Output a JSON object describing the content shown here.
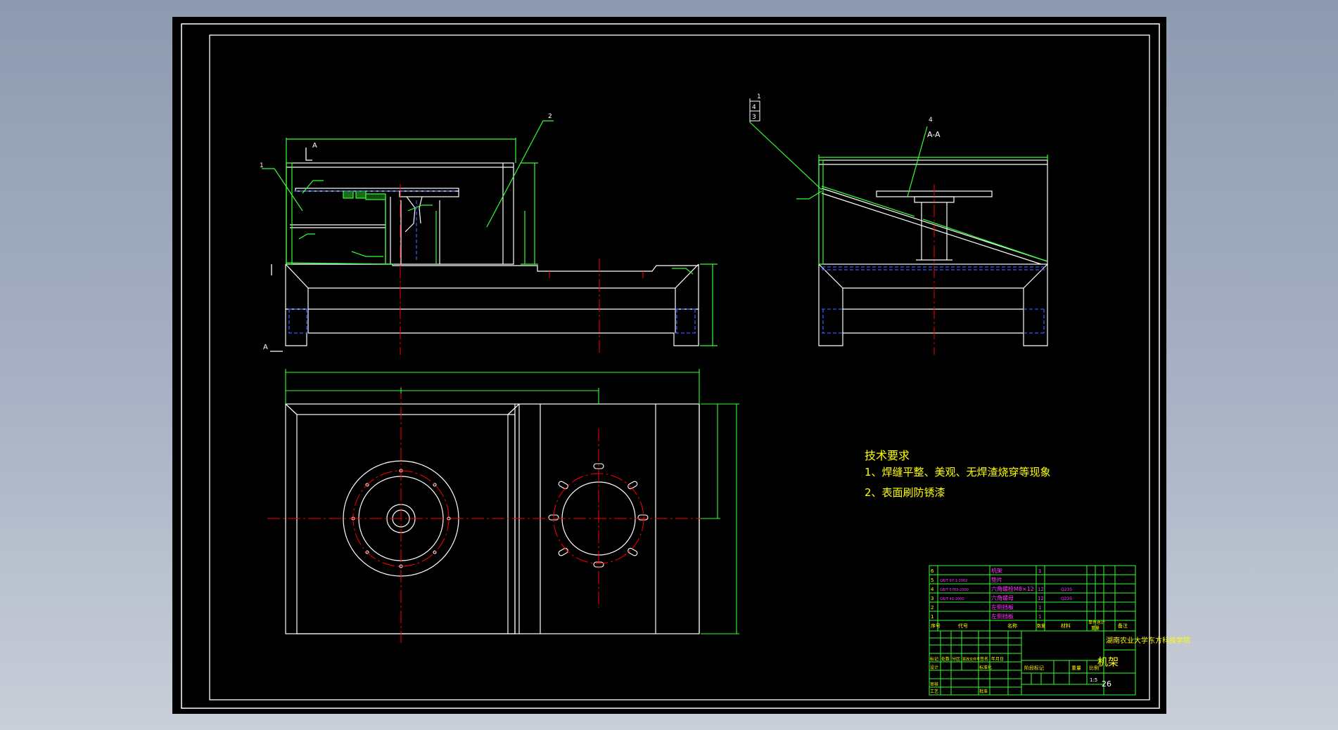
{
  "drawing": {
    "title_block": {
      "university": "湖南农业大学东方科技学院",
      "part_name": "机架",
      "drawing_no": "26",
      "scale": "1:5",
      "column_headers": [
        "序号",
        "代号",
        "名称",
        "数量",
        "材料",
        "单件",
        "总计",
        "重量",
        "备注"
      ],
      "approval_labels": [
        "标记",
        "处数",
        "分区",
        "更改文件号",
        "签名",
        "年月日",
        "设计",
        "标准化",
        "审核",
        "工艺",
        "批准",
        "阶段标记",
        "重量",
        "比例"
      ],
      "parts": [
        {
          "no": "6",
          "code": "",
          "name": "机架",
          "qty": "1",
          "material": ""
        },
        {
          "no": "5",
          "code": "GB/T 97.1-2002",
          "name": "垫片",
          "qty": "",
          "material": ""
        },
        {
          "no": "4",
          "code": "GB/T 5783-2000",
          "name": "六角螺栓M8×12",
          "qty": "12",
          "material": "Q235"
        },
        {
          "no": "3",
          "code": "GB/T 41-2000",
          "name": "六角螺母",
          "qty": "12",
          "material": "Q235"
        },
        {
          "no": "2",
          "code": "",
          "name": "左侧挡板",
          "qty": "1",
          "material": ""
        },
        {
          "no": "1",
          "code": "",
          "name": "左侧挡板",
          "qty": "1",
          "material": ""
        }
      ]
    },
    "notes": {
      "heading": "技术要求",
      "items": [
        "1、焊缝平整、美观、无焊渣烧穿等现象",
        "2、表面刷防锈漆"
      ]
    },
    "section_label": "A-A",
    "view_marker": "A",
    "balloons": [
      "1",
      "2",
      "3",
      "4"
    ],
    "colors": {
      "background": "#000000",
      "geometry": "#ffffff",
      "centerline": "#ff0000",
      "dimension": "#33ff33",
      "hidden": "#3355ff",
      "text_yellow": "#ffff00",
      "text_magenta": "#ff33ff"
    }
  }
}
